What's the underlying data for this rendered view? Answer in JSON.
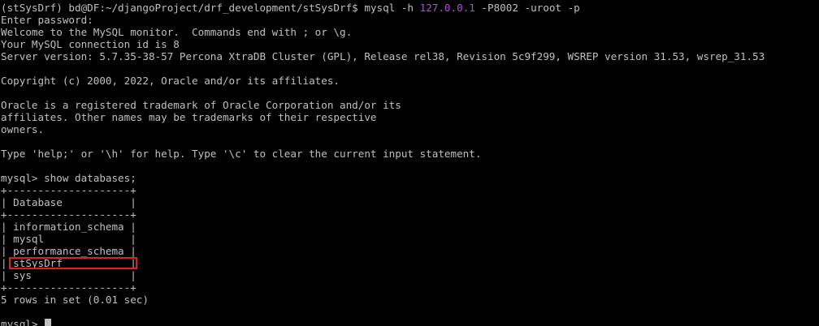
{
  "terminal": {
    "prompt_line": {
      "prefix": "(stSysDrf) bd@DF:~/djangoProject/drf_development/stSysDrf$ ",
      "command": "mysql -h ",
      "host": "127.0.0.1",
      "port_arg": " -P8002",
      "rest": " -uroot -p"
    },
    "login_lines": [
      "Enter password:",
      "Welcome to the MySQL monitor.  Commands end with ; or \\g.",
      "Your MySQL connection id is 8",
      "Server version: 5.7.35-38-57 Percona XtraDB Cluster (GPL), Release rel38, Revision 5c9f299, WSREP version 31.53, wsrep_31.53"
    ],
    "copyright_line": "Copyright (c) 2000, 2022, Oracle and/or its affiliates.",
    "trademark_lines": [
      "Oracle is a registered trademark of Oracle Corporation and/or its",
      "affiliates. Other names may be trademarks of their respective",
      "owners."
    ],
    "help_line": "Type 'help;' or '\\h' for help. Type '\\c' to clear the current input statement.",
    "query_line": "mysql> show databases;",
    "table": {
      "border": "+--------------------+",
      "header": "| Database           |",
      "rows": [
        "| information_schema |",
        "| mysql              |",
        "| performance_schema |",
        "| stSysDrf           |",
        "| sys                |"
      ]
    },
    "result_line": "5 rows in set (0.01 sec)",
    "final_prompt": "mysql> ",
    "colors": {
      "background": "#000000",
      "text": "#c0c0c0",
      "host_highlight": "#b44ddb",
      "annotation_box": "#e0201e"
    }
  }
}
